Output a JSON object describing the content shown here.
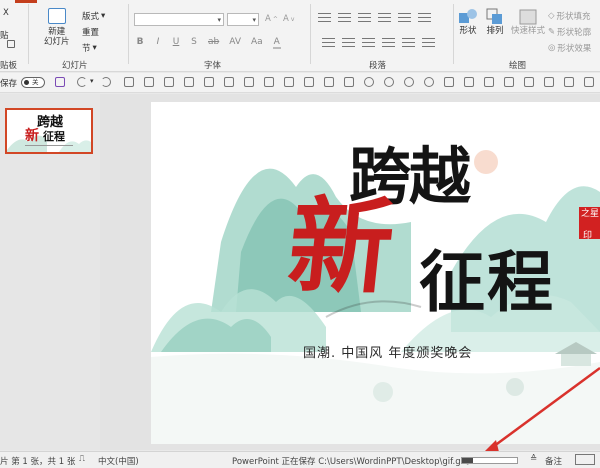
{
  "ribbon": {
    "groups": {
      "clipboard": "贴板",
      "slides": "幻灯片",
      "font": "字体",
      "paragraph": "段落",
      "drawing": "绘图"
    },
    "clipboard": {
      "cut_glyph": "X",
      "paste_label": "贴"
    },
    "slides": {
      "new_slide_line1": "新建",
      "new_slide_line2": "幻灯片",
      "layout": "版式",
      "reset": "重置",
      "section": "节"
    },
    "font": {
      "bold": "B",
      "italic": "I",
      "underline": "U",
      "strike": "S",
      "shadow": "ab",
      "spacing": "AV",
      "case": "Aa",
      "color": "A"
    },
    "drawing": {
      "shapes": "形状",
      "arrange": "排列",
      "quick_styles": "快速样式",
      "shape_fill": "形状填充",
      "shape_outline": "形状轮廓",
      "shape_effects": "形状效果"
    }
  },
  "qat": {
    "autosave": "保存",
    "toggle": "关"
  },
  "slide": {
    "title_line1": "跨越",
    "title_accent": "新",
    "title_line2": "征程",
    "subtitle": "国潮. 中国风  年度颁奖晚会",
    "seal_top": "之星",
    "seal_bottom": "印"
  },
  "thumbnail": {
    "line1": "跨越",
    "accent": "新",
    "line2": "征程"
  },
  "status": {
    "slide_position": "片 第 1 张，共 1 张",
    "language": "中文(中国)",
    "saving_message": "PowerPoint 正在保存 C:\\Users\\WordinPPT\\Desktop\\gif.gif。",
    "progress": 0.2,
    "notes": "备注"
  },
  "colors": {
    "accent": "#c43e1c",
    "thumb_border": "#d24726",
    "seal": "#d22121",
    "mountain": "#86c8b6",
    "arrow": "#d9322c"
  }
}
